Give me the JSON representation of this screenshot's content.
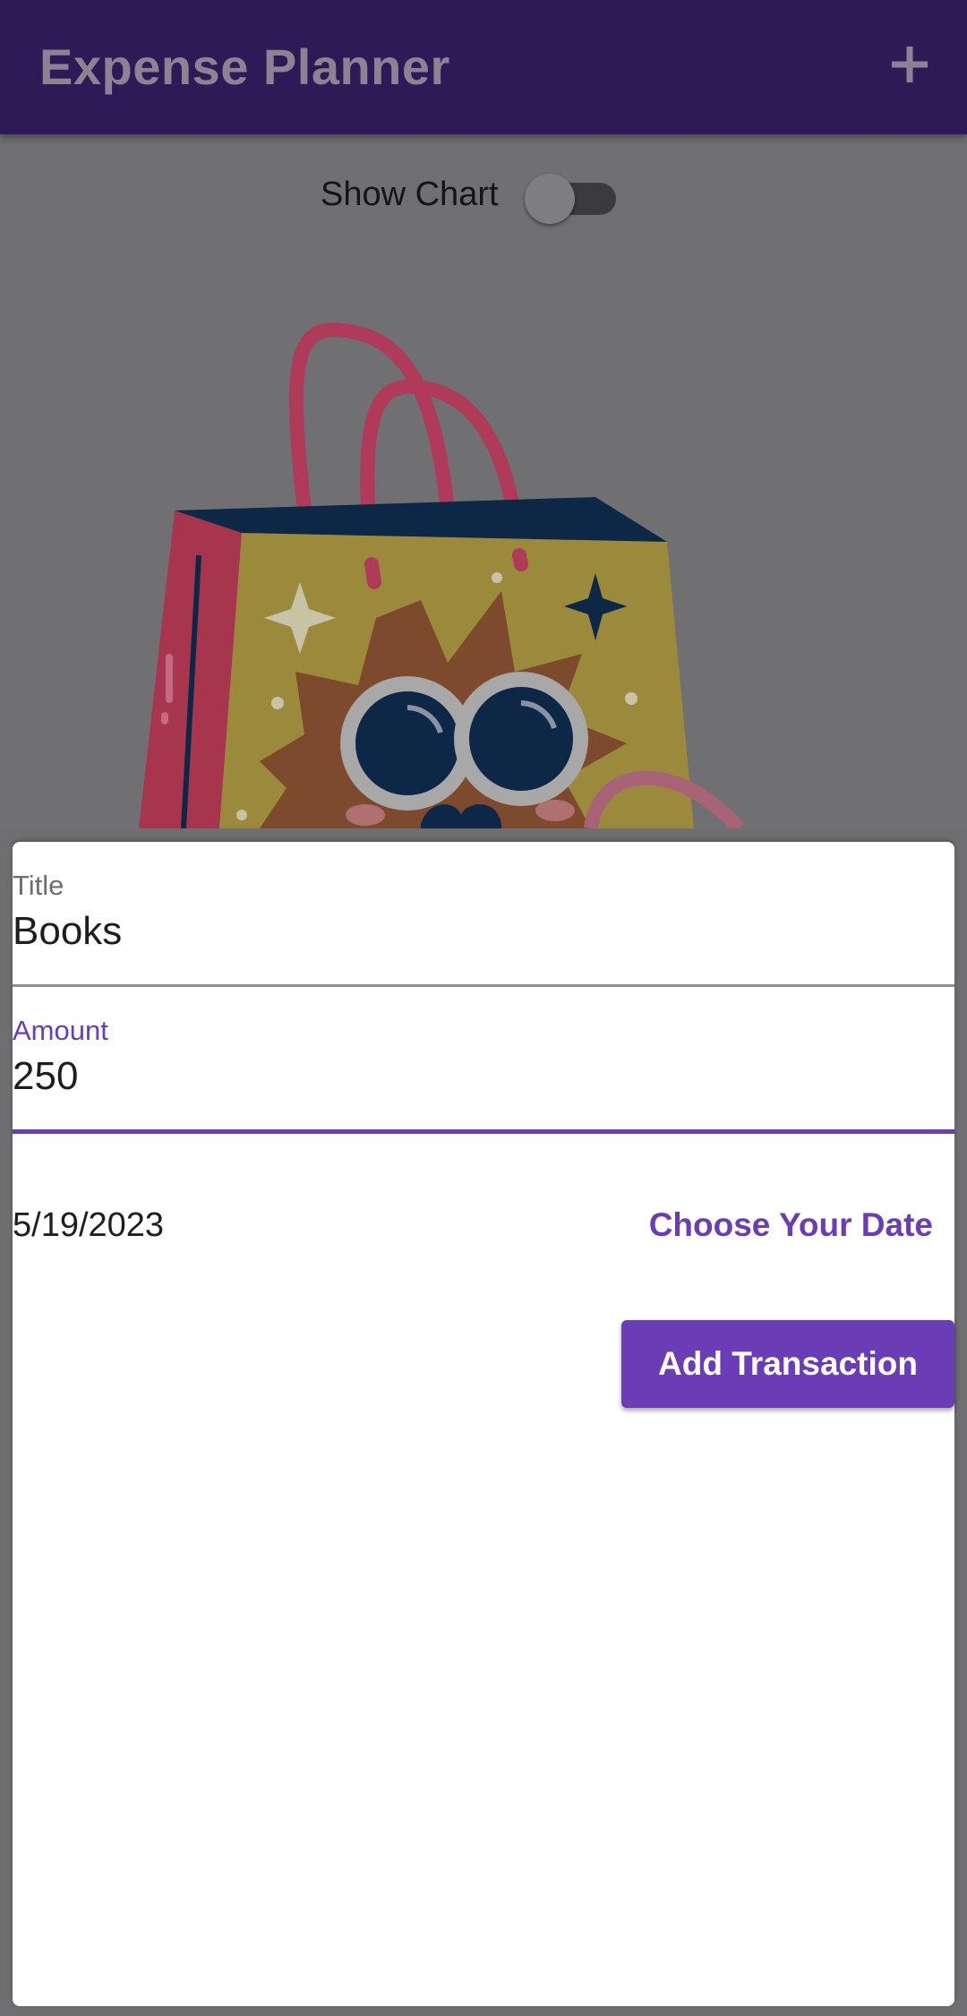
{
  "app_bar": {
    "title": "Expense Planner",
    "add_icon": "plus-icon",
    "background_color": "#2e1a57"
  },
  "chart_toggle": {
    "label": "Show Chart",
    "on": false
  },
  "illustration": {
    "icon": "shopping-bag-icon"
  },
  "form": {
    "title_field": {
      "label": "Title",
      "value": "Books"
    },
    "amount_field": {
      "label": "Amount",
      "value": "250",
      "focused": true
    },
    "selected_date": "5/19/2023",
    "choose_date_label": "Choose Your Date",
    "submit_label": "Add Transaction",
    "accent_color": "#6a3db7"
  }
}
